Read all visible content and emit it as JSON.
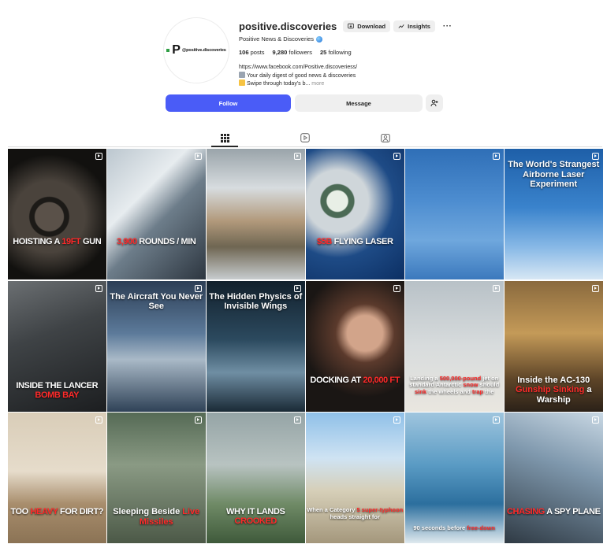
{
  "profile": {
    "avatar_handle": "@positive.discoveries",
    "username": "positive.discoveries",
    "display_name": "Positive News & Discoveries",
    "download_label": "Download",
    "insights_label": "Insights",
    "more_label": "···",
    "stats": {
      "posts_count": "106",
      "posts_label": "posts",
      "followers_count": "9,280",
      "followers_label": "followers",
      "following_count": "25",
      "following_label": "following"
    },
    "bio": {
      "link": "https://www.facebook.com/Positive.discoveriess/",
      "line1": "Your daily digest of good news & discoveries",
      "line2": "Swipe through today's b...",
      "more": "more"
    }
  },
  "actions": {
    "follow_label": "Follow",
    "message_label": "Message"
  },
  "tabs": [
    {
      "icon": "grid-icon",
      "active": true
    },
    {
      "icon": "reels-icon",
      "active": false
    },
    {
      "icon": "tagged-icon",
      "active": false
    }
  ],
  "posts": [
    {
      "pre": "Hoisting a ",
      "hl": "19ft",
      "post": " gun",
      "style": "big",
      "pos": "mid"
    },
    {
      "pre": "",
      "hl": "3,900",
      "post": " rounds / min",
      "style": "big",
      "pos": "mid"
    },
    {
      "pre": "",
      "hl": "",
      "post": "",
      "style": "big",
      "pos": "mid"
    },
    {
      "pre": "",
      "hl": "$5B",
      "post": " flying laser",
      "style": "big",
      "pos": "mid"
    },
    {
      "pre": "",
      "hl": "",
      "post": "",
      "style": "big",
      "pos": "mid"
    },
    {
      "pre": "The World's Strangest Airborne Laser Experiment",
      "hl": "",
      "post": "",
      "style": "title",
      "pos": "top"
    },
    {
      "pre": "Inside the Lancer ",
      "hl": "bomb bay",
      "post": "",
      "style": "big",
      "pos": "bottom"
    },
    {
      "pre": "The Aircraft You Never See",
      "hl": "",
      "post": "",
      "style": "title",
      "pos": "top"
    },
    {
      "pre": "The Hidden Physics of Invisible Wings",
      "hl": "",
      "post": "",
      "style": "title",
      "pos": "top"
    },
    {
      "pre": "Docking at ",
      "hl": "20,000 ft",
      "post": "",
      "style": "big",
      "pos": "lower"
    },
    {
      "pre": "Landing a ",
      "hl": "500,000-pound",
      "post": " jet on standard Antarctic ",
      "hl2": "snow",
      "post2": " should ",
      "hl3": "sink",
      "post3": " the wheels and ",
      "hl4": "trap",
      "post4": " the",
      "style": "small",
      "pos": "lower"
    },
    {
      "pre": "Inside the AC-130 ",
      "hl": "Gunship",
      "post": " ",
      "hl2": "Sinking",
      "post2": " a Warship",
      "style": "title",
      "pos": "lower"
    },
    {
      "pre": "Too ",
      "hl": "heavy",
      "post": " for dirt?",
      "style": "big",
      "pos": "lower"
    },
    {
      "pre": "Sleeping Beside ",
      "hl": "Live Missiles",
      "post": "",
      "style": "title",
      "pos": "lower"
    },
    {
      "pre": "Why it lands ",
      "hl": "crooked",
      "post": "",
      "style": "big",
      "pos": "lower"
    },
    {
      "pre": "When a Category ",
      "hl": "5 super-typhoon",
      "post": " heads straight for",
      "style": "small",
      "pos": "lower"
    },
    {
      "pre": "90 seconds before ",
      "hl": "free-down",
      "post": "",
      "style": "small",
      "pos": "bottom"
    },
    {
      "pre": "",
      "hl": "Chasing",
      "post": " a spy plane",
      "style": "big",
      "pos": "lower"
    }
  ]
}
